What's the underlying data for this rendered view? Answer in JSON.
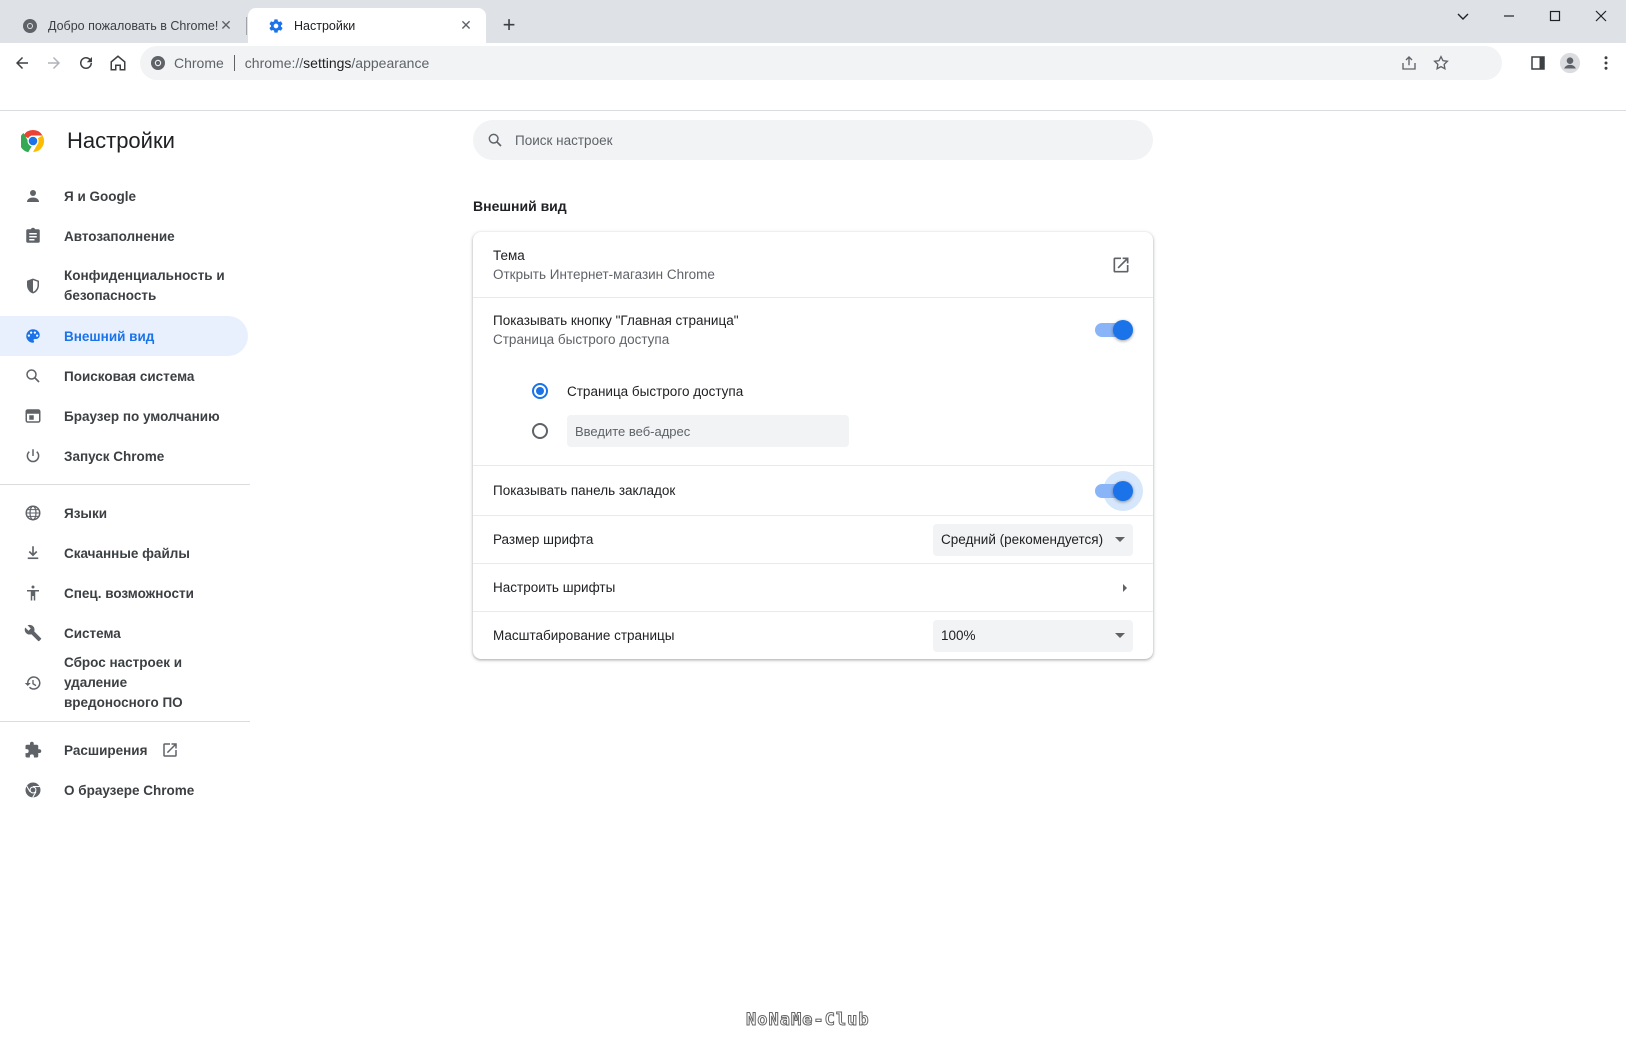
{
  "tabs": [
    {
      "title": "Добро пожаловать в Chrome!",
      "active": false
    },
    {
      "title": "Настройки",
      "active": true
    }
  ],
  "omnibox": {
    "site_label": "Chrome",
    "url_scheme": "chrome://",
    "url_host": "settings",
    "url_path": "/appearance"
  },
  "brand": {
    "title": "Настройки"
  },
  "nav": {
    "you_google": "Я и Google",
    "autofill": "Автозаполнение",
    "privacy_line1": "Конфиденциальность и",
    "privacy_line2": "безопасность",
    "appearance": "Внешний вид",
    "search_engine": "Поисковая система",
    "default_browser": "Браузер по умолчанию",
    "on_startup": "Запуск Chrome",
    "languages": "Языки",
    "downloads": "Скачанные файлы",
    "accessibility": "Спец. возможности",
    "system": "Система",
    "reset_line1": "Сброс настроек и удаление",
    "reset_line2": "вредоносного ПО",
    "extensions": "Расширения",
    "about": "О браузере Chrome"
  },
  "search": {
    "placeholder": "Поиск настроек"
  },
  "section": {
    "title": "Внешний вид"
  },
  "appearance": {
    "theme_title": "Тема",
    "theme_sub": "Открыть Интернет-магазин Chrome",
    "home_title": "Показывать кнопку \"Главная страница\"",
    "home_sub": "Страница быстрого доступа",
    "home_enabled": true,
    "radio_ntp": "Страница быстрого доступа",
    "radio_ntp_checked": true,
    "radio_url_placeholder": "Введите веб-адрес",
    "bookmarks_title": "Показывать панель закладок",
    "bookmarks_enabled": true,
    "font_size_label": "Размер шрифта",
    "font_size_value": "Средний (рекомендуется)",
    "customize_fonts": "Настроить шрифты",
    "zoom_label": "Масштабирование страницы",
    "zoom_value": "100%"
  },
  "colors": {
    "accent": "#1a73e8",
    "accent_light": "#8ab4f8",
    "active_bg": "#e8f0fe"
  },
  "watermark": "NoNaMe-Club"
}
